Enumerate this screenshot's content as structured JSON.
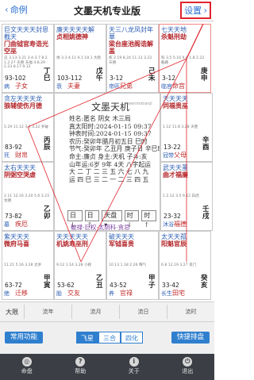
{
  "header": {
    "title": "文墨天机专业版",
    "left_label": "命例",
    "right_label": "设置"
  },
  "palaces": [
    {
      "stars": "巨文天天天封恩截天",
      "main": "门曲钺官寿诰光空巫",
      "small": "忌 3.13-3.21 3.4-3.7 8.2 1.2.27\n天德 天福 4.8.29 2.23 8.17 9.12",
      "age": "93-102",
      "gz": "丁巳",
      "name": "子女",
      "cs": "病"
    },
    {
      "stars": "廉天天天天解",
      "main": "贞相姚德神",
      "small": "禄 3.3 4.11 9.1 18.1\n大耗",
      "age": "103-112",
      "gz": "戊午",
      "name": "夫妻",
      "cs": "衰"
    },
    {
      "stars": "天三八龙凤封年華",
      "main": "梁台座池阁诰解盖",
      "small": "权 2.19 8.24 11.13 3.22\n天德",
      "age": "3-12",
      "gz": "己未",
      "name": "兄弟",
      "cs": "帝旺"
    },
    {
      "stars": "七天天地",
      "main": "杀魁刑劫",
      "small": "科 3.5 5.16 9.4 1.8 2.22\n截路",
      "age": "3-12",
      "gz": "庚申",
      "name": "命宫",
      "cs": "临官"
    },
    {
      "stars": "贪左天天天龙",
      "main": "狼辅使伤月德",
      "small": "5.19 11.12 3.4 3.22\n岁破",
      "age": "83-92",
      "gz": "丙辰",
      "name": "财帛",
      "cs": "死"
    },
    {
      "stars": "天天天天",
      "main": "同福贵巫",
      "small": "1.12 11.8 3.28\n天使",
      "age": "13-22",
      "gz": "辛酉",
      "name": "父母",
      "cs": "冠带"
    },
    {
      "stars": "太右天天天",
      "main": "阴弼空哭虚",
      "small": "2.11 12.16 3.20 5.6 3.23\n龙德",
      "age": "73-82",
      "gz": "乙卯",
      "name": "疾厄",
      "cs": "墓"
    },
    {
      "stars": "武天天蜚",
      "main": "曲才福廉",
      "small": "1.2.12 3.5 9.12\n白虎",
      "age": "23-32",
      "gz": "壬戌",
      "name": "福德",
      "cs": "沐浴"
    },
    {
      "stars": "紫天天天",
      "main": "微府马喜",
      "small": "11.21 5.16 3.28\n太岁",
      "age": "63-72",
      "gz": "甲寅",
      "name": "迁移",
      "cs": "绝"
    },
    {
      "stars": "天天天天天",
      "main": "机姚寿巫刑",
      "small": "9.12 1.14 3.28\n小耗",
      "age": "53-62",
      "gz": "乙丑",
      "name": "交友",
      "cs": "胎"
    },
    {
      "stars": "破天天天",
      "main": "军钺喜贵",
      "small": "10.13 1.18 2.26\n晦气",
      "age": "43-52",
      "gz": "甲子",
      "name": "官禄",
      "cs": "养"
    },
    {
      "stars": "太天天孤",
      "main": "阳魁官辰",
      "small": "6.8 12.19 3.27\n丧门",
      "age": "33-42",
      "gz": "癸亥",
      "name": "田宅",
      "cs": "长生"
    }
  ],
  "center": {
    "app_name": "文墨天机",
    "watermark": "wenmotianji",
    "lines": [
      "姓名:匿名        阴女 木三局",
      "真太阳时:2024-01-15 09:37",
      "钟表时间:2024-01-15 09:37",
      "农历:癸卯年腊月初五日 巳时",
      "节气:癸卯年 乙丑月 庚子日 辛巳时",
      "命主:廉贞 身主:天机 子斗:亥",
      "山年运:6岁 9年 4天 八字起运",
      "大 二 丁 二 三 五 六 七 八 九",
      "运 四 巳 三 二 一 二 三 四 五"
    ],
    "controls": [
      "日↓",
      "日↑",
      "天盘 ▾",
      "时↓",
      "时↑"
    ],
    "sihua": "破禄·巨权·太阴科·贪忌"
  },
  "timeline": [
    "大限",
    "流年",
    "流月",
    "流日",
    "流时"
  ],
  "actions": {
    "common": "常用功能",
    "quick": "快捷排盘",
    "modes": [
      "飞星",
      "三合",
      "四化"
    ],
    "active_mode": "三合"
  },
  "tabs": [
    {
      "label": "命盘",
      "icon": "chart-icon"
    },
    {
      "label": "帮助",
      "icon": "help-icon"
    },
    {
      "label": "关于",
      "icon": "about-icon"
    },
    {
      "label": "退出",
      "icon": "exit-icon"
    }
  ],
  "colors": {
    "accent": "#2f7fcf",
    "highlight_red": "#e0242d",
    "tabbar_bg": "#3b3f45"
  }
}
